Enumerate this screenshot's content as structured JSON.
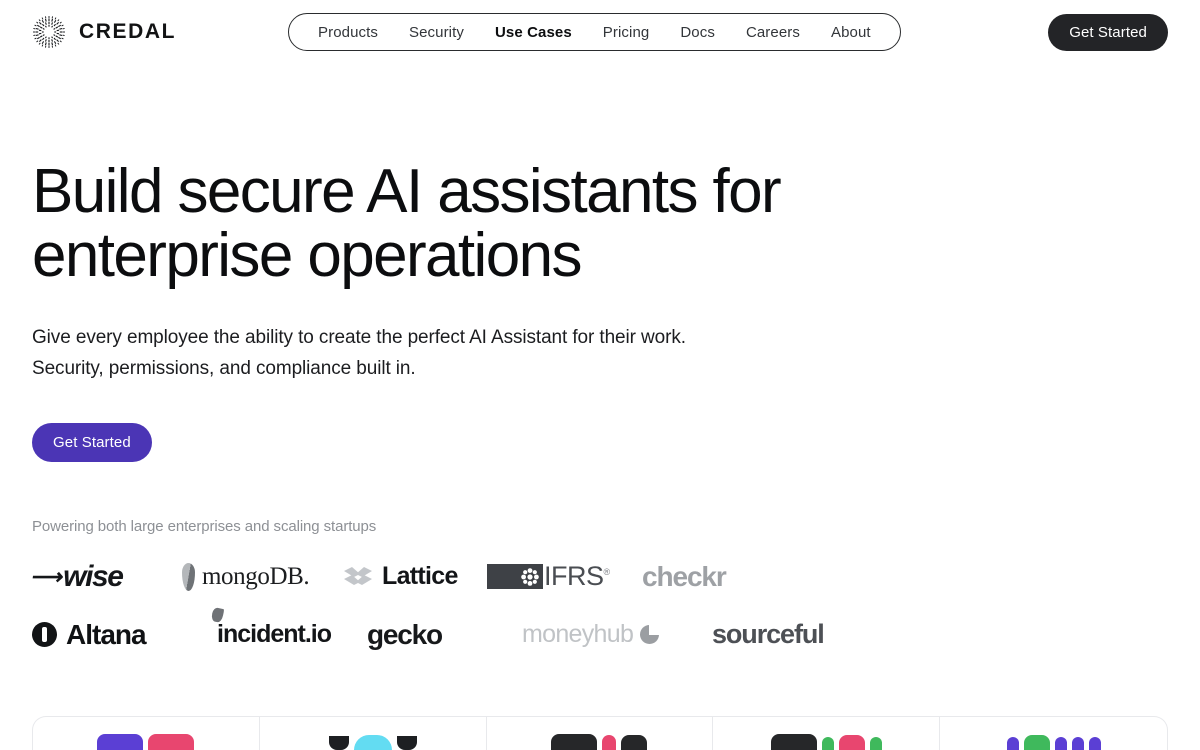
{
  "header": {
    "brand": {
      "name": "CREDAL",
      "mark_icon": "credal-radial-logo-icon"
    },
    "nav": [
      {
        "label": "Products",
        "active": false
      },
      {
        "label": "Security",
        "active": false
      },
      {
        "label": "Use Cases",
        "active": true
      },
      {
        "label": "Pricing",
        "active": false
      },
      {
        "label": "Docs",
        "active": false
      },
      {
        "label": "Careers",
        "active": false
      },
      {
        "label": "About",
        "active": false
      }
    ],
    "cta_label": "Get Started",
    "cta_color": "#232427"
  },
  "hero": {
    "title_line1": "Build secure AI assistants for",
    "title_line2": "enterprise operations",
    "sub_line1": "Give every employee the ability to create the perfect AI Assistant for their work.",
    "sub_line2": "Security, permissions, and compliance built in.",
    "cta_label": "Get Started",
    "cta_color": "#4b35b5"
  },
  "logos": {
    "caption": "Powering both large enterprises and scaling startups",
    "row1": [
      {
        "name": "Wise",
        "wordmark": "wise"
      },
      {
        "name": "MongoDB",
        "wordmark": "mongoDB."
      },
      {
        "name": "Lattice",
        "wordmark": "Lattice"
      },
      {
        "name": "IFRS",
        "wordmark": "IFRS"
      },
      {
        "name": "Checkr",
        "wordmark": "checkr"
      }
    ],
    "row2": [
      {
        "name": "Altana",
        "wordmark": "Altana"
      },
      {
        "name": "incident.io",
        "wordmark": "incident.io"
      },
      {
        "name": "Gecko",
        "wordmark": "gecko"
      },
      {
        "name": "Moneyhub",
        "wordmark": "moneyhub"
      },
      {
        "name": "Sourceful",
        "wordmark": "sourceful"
      }
    ]
  },
  "cards": [
    {
      "name": "card-1",
      "shapes": [
        {
          "shape": "slant",
          "color": "#5b3fd4"
        },
        {
          "shape": "bar",
          "color": "#e8466f"
        }
      ]
    },
    {
      "name": "card-2",
      "shapes": [
        {
          "shape": "tab",
          "color": "#1d1f22"
        },
        {
          "shape": "dome",
          "color": "#63dcf2"
        },
        {
          "shape": "tab",
          "color": "#1d1f22"
        }
      ]
    },
    {
      "name": "card-3",
      "shapes": [
        {
          "shape": "bar",
          "color": "#262729"
        },
        {
          "shape": "dot",
          "color": "#e8466f"
        },
        {
          "shape": "pill",
          "color": "#262729"
        }
      ]
    },
    {
      "name": "card-4",
      "shapes": [
        {
          "shape": "bar",
          "color": "#262729"
        },
        {
          "shape": "dotsm",
          "color": "#3fb95c"
        },
        {
          "shape": "pill",
          "color": "#e8466f"
        },
        {
          "shape": "dotsm",
          "color": "#3fb95c"
        }
      ]
    },
    {
      "name": "card-5",
      "shapes": [
        {
          "shape": "dotsm",
          "color": "#5b3fd4"
        },
        {
          "shape": "pill",
          "color": "#3fb95c"
        },
        {
          "shape": "dotsm",
          "color": "#5b3fd4"
        },
        {
          "shape": "dotsm",
          "color": "#5b3fd4"
        },
        {
          "shape": "dotsm",
          "color": "#5b3fd4"
        }
      ]
    }
  ]
}
